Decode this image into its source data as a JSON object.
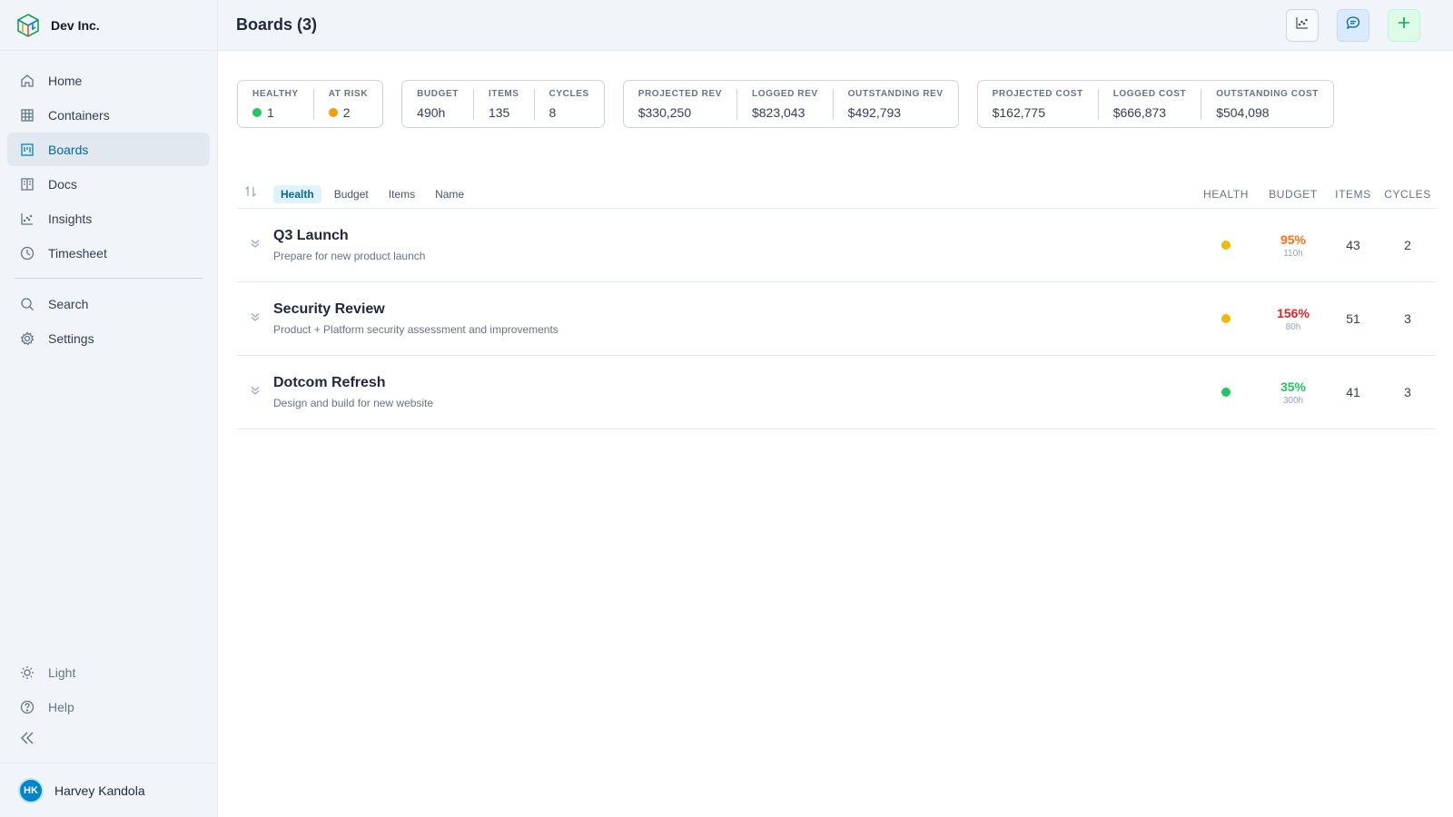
{
  "app": {
    "name": "Dev Inc."
  },
  "sidebar": {
    "items": [
      {
        "label": "Home",
        "icon": "home-icon"
      },
      {
        "label": "Containers",
        "icon": "grid-icon"
      },
      {
        "label": "Boards",
        "icon": "board-icon",
        "active": true
      },
      {
        "label": "Docs",
        "icon": "book-icon"
      },
      {
        "label": "Insights",
        "icon": "chart-icon"
      },
      {
        "label": "Timesheet",
        "icon": "clock-icon"
      }
    ],
    "secondary": [
      {
        "label": "Search",
        "icon": "search-icon"
      },
      {
        "label": "Settings",
        "icon": "gear-icon"
      }
    ],
    "bottom": [
      {
        "label": "Light",
        "icon": "sun-icon"
      },
      {
        "label": "Help",
        "icon": "help-icon"
      }
    ],
    "user": {
      "initials": "HK",
      "name": "Harvey Kandola"
    }
  },
  "header": {
    "title": "Boards (3)"
  },
  "stats": {
    "health": {
      "healthy_label": "Healthy",
      "healthy_value": "1",
      "at_risk_label": "At Risk",
      "at_risk_value": "2"
    },
    "work": {
      "budget_label": "Budget",
      "budget_value": "490h",
      "items_label": "Items",
      "items_value": "135",
      "cycles_label": "Cycles",
      "cycles_value": "8"
    },
    "revenue": {
      "projected_label": "Projected Rev",
      "projected_value": "$330,250",
      "logged_label": "Logged Rev",
      "logged_value": "$823,043",
      "outstanding_label": "Outstanding Rev",
      "outstanding_value": "$492,793"
    },
    "cost": {
      "projected_label": "Projected Cost",
      "projected_value": "$162,775",
      "logged_label": "Logged Cost",
      "logged_value": "$666,873",
      "outstanding_label": "Outstanding Cost",
      "outstanding_value": "$504,098"
    }
  },
  "table": {
    "sort_tabs": [
      "Health",
      "Budget",
      "Items",
      "Name"
    ],
    "active_sort": "Health",
    "columns": {
      "health": "HEALTH",
      "budget": "BUDGET",
      "items": "ITEMS",
      "cycles": "CYCLES"
    },
    "rows": [
      {
        "name": "Q3 Launch",
        "description": "Prepare for new product launch",
        "health": "yellow",
        "budget_pct": "95%",
        "budget_color": "orange",
        "budget_hours": "110h",
        "items": "43",
        "cycles": "2"
      },
      {
        "name": "Security Review",
        "description": "Product + Platform security assessment and improvements",
        "health": "yellow",
        "budget_pct": "156%",
        "budget_color": "red",
        "budget_hours": "80h",
        "items": "51",
        "cycles": "3"
      },
      {
        "name": "Dotcom Refresh",
        "description": "Design and build for new website",
        "health": "green",
        "budget_pct": "35%",
        "budget_color": "green",
        "budget_hours": "300h",
        "items": "41",
        "cycles": "3"
      }
    ]
  },
  "colors": {
    "accent": "#0284c7",
    "healthy": "#22c55e",
    "at_risk": "#f59e0b",
    "over_budget": "#dc2626"
  }
}
